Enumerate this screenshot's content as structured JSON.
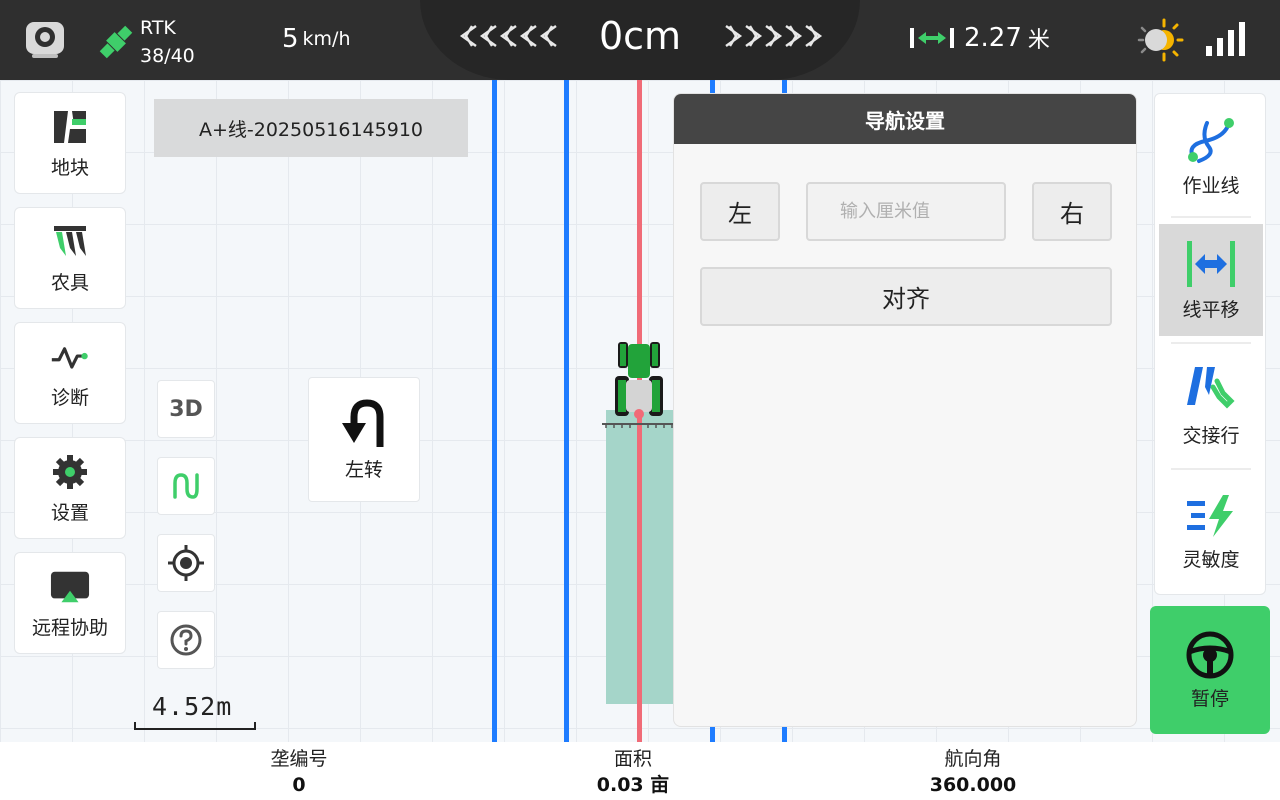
{
  "status_bar": {
    "gps_mode": "RTK",
    "satellites": "38/40",
    "speed_value": "5",
    "speed_unit": "km/h",
    "offset": "0cm",
    "implement_width_value": "2.27",
    "implement_width_unit": "米"
  },
  "line_name": "A+线-20250516145910",
  "left_menu": [
    {
      "label": "地块",
      "icon": "field-icon"
    },
    {
      "label": "农具",
      "icon": "implement-icon"
    },
    {
      "label": "诊断",
      "icon": "diagnosis-icon"
    },
    {
      "label": "设置",
      "icon": "settings-gear-icon"
    },
    {
      "label": "远程协助",
      "icon": "remote-assist-icon"
    }
  ],
  "tools": {
    "view_3d_label": "3D",
    "turn_label": "左转"
  },
  "scale_text": "4.52m",
  "nav_panel": {
    "title": "导航设置",
    "left_label": "左",
    "right_label": "右",
    "input_placeholder": "输入厘米值",
    "align_label": "对齐"
  },
  "right_menu": [
    {
      "label": "作业线",
      "icon": "work-line-icon"
    },
    {
      "label": "线平移",
      "icon": "line-shift-icon",
      "active": true
    },
    {
      "label": "交接行",
      "icon": "row-join-icon"
    },
    {
      "label": "灵敏度",
      "icon": "sensitivity-icon"
    }
  ],
  "pause_label": "暂停",
  "stats": [
    {
      "label": "垄编号",
      "value": "0"
    },
    {
      "label": "面积",
      "value": "0.03 亩"
    },
    {
      "label": "航向角",
      "value": "360.000"
    }
  ],
  "colors": {
    "guide_line": "#1e7cff",
    "current_line": "#f06b77",
    "worked_area": "#a5d5c9",
    "accent_green": "#3fce6a"
  }
}
